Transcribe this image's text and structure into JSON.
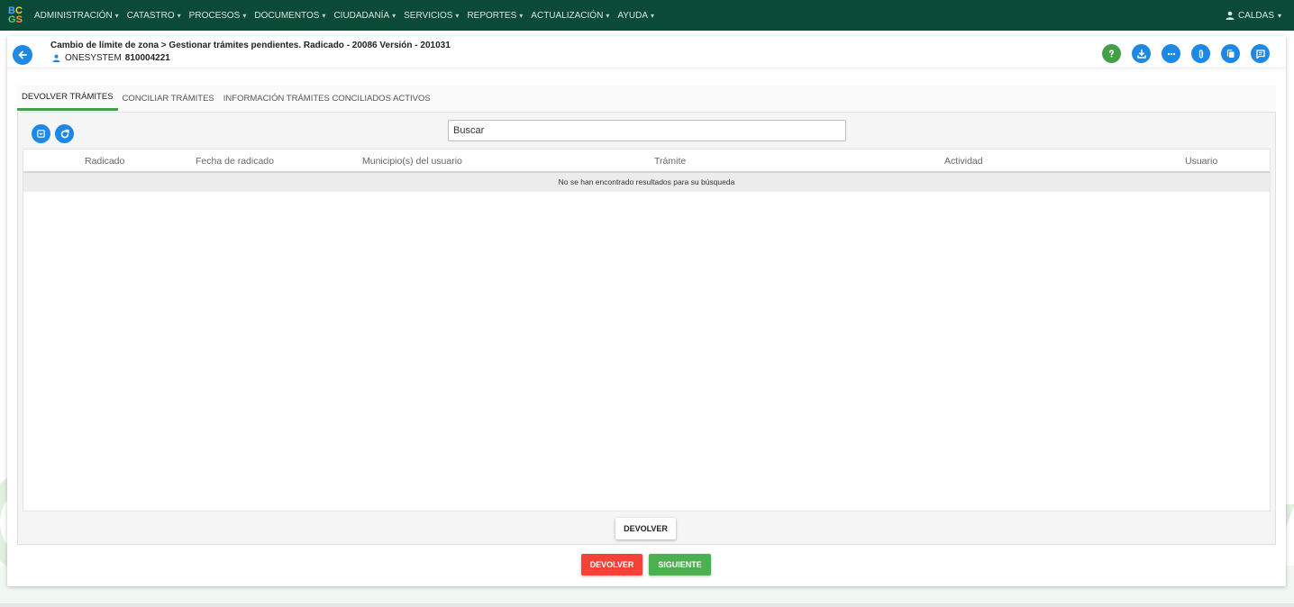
{
  "navbar": {
    "logo": {
      "row1": [
        "B",
        "C"
      ],
      "row2": [
        "G",
        "S"
      ]
    },
    "menu": [
      "ADMINISTRACIÓN",
      "CATASTRO",
      "PROCESOS",
      "DOCUMENTOS",
      "CIUDADANÍA",
      "SERVICIOS",
      "REPORTES",
      "ACTUALIZACIÓN",
      "AYUDA"
    ],
    "caret": "▾",
    "user": "CALDAS"
  },
  "header": {
    "title": "Cambio de límite de zona > Gestionar trámites pendientes. Radicado - 20086 Versión - 201031",
    "user_name": "ONESYSTEM",
    "user_code": "810004221"
  },
  "tabs": [
    "DEVOLVER TRÁMITES",
    "CONCILIAR TRÁMITES",
    "INFORMACIÓN TRÁMITES CONCILIADOS ACTIVOS"
  ],
  "search": {
    "placeholder": "Buscar"
  },
  "table": {
    "columns": [
      "Radicado",
      "Fecha de radicado",
      "Municipio(s) del usuario",
      "Trámite",
      "Actividad",
      "Usuario"
    ],
    "empty_message": "No se han encontrado resultados para su búsqueda"
  },
  "buttons": {
    "devolver_inner": "DEVOLVER",
    "devolver": "DEVOLVER",
    "siguiente": "SIGUIENTE"
  },
  "colors": {
    "navbar": "#0b4a36",
    "primary": "#1e88e5",
    "success": "#4caf50",
    "danger": "#f44336",
    "tab_active": "#43a047"
  }
}
